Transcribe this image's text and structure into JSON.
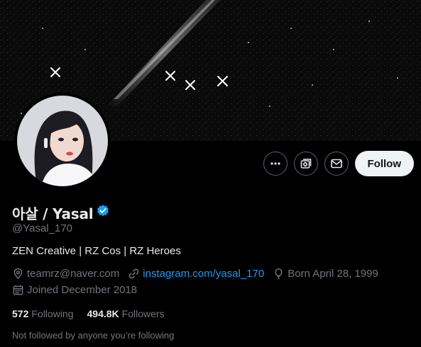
{
  "profile": {
    "display_name": "아살 / Yasal",
    "handle": "@Yasal_170",
    "bio": "ZEN Creative | RZ Cos | RZ Heroes",
    "location": "teamrz@naver.com",
    "website": "instagram.com/yasal_170",
    "birthday": "Born April 28, 1999",
    "joined": "Joined December 2018",
    "verified": true
  },
  "stats": {
    "following_count": "572",
    "following_label": "Following",
    "followers_count": "494.8K",
    "followers_label": "Followers"
  },
  "follow_note": "Not followed by anyone you’re following",
  "actions": {
    "follow_label": "Follow",
    "more_icon": "more-horizontal-icon",
    "subscribe_icon": "notifications-subscribe-icon",
    "message_icon": "envelope-icon"
  },
  "colors": {
    "background": "#000000",
    "text_primary": "#e7e9ea",
    "text_secondary": "#71767b",
    "link": "#1d9bf0",
    "verified_badge": "#1d9bf0",
    "follow_button_bg": "#eff3f4"
  }
}
